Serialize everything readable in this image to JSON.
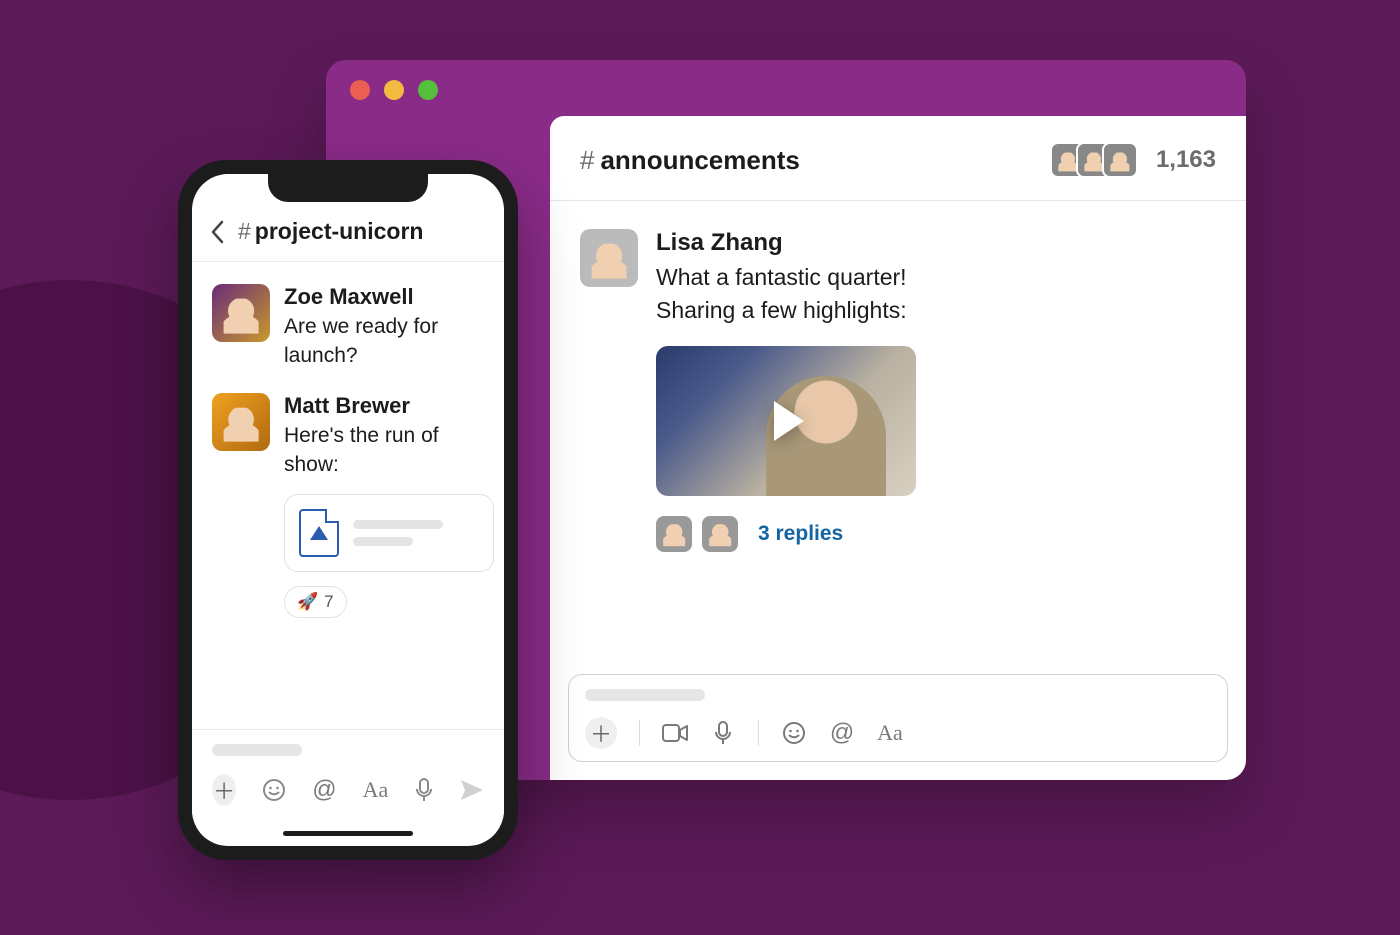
{
  "desktop": {
    "channel_name": "announcements",
    "member_count": "1,163",
    "message": {
      "author": "Lisa Zhang",
      "text_line1": "What a fantastic quarter!",
      "text_line2": "Sharing a few highlights:"
    },
    "thread": {
      "replies_label": "3 replies"
    }
  },
  "phone": {
    "channel_name": "project-unicorn",
    "messages": [
      {
        "author": "Zoe Maxwell",
        "text": "Are we ready for launch?"
      },
      {
        "author": "Matt Brewer",
        "text": "Here's the run of show:"
      }
    ],
    "reaction": {
      "emoji": "🚀",
      "count": "7"
    }
  }
}
